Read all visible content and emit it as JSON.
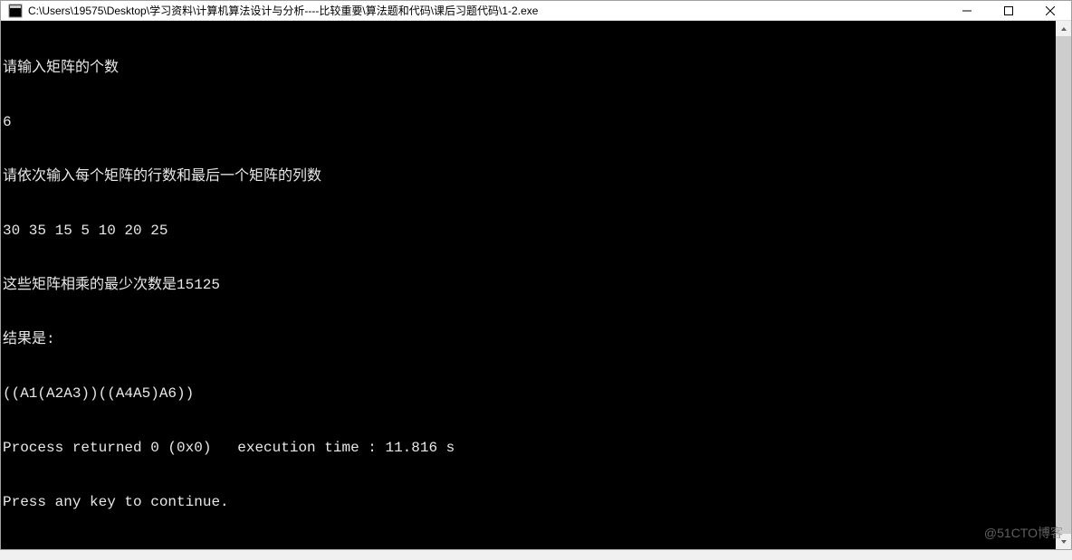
{
  "window": {
    "title": "C:\\Users\\19575\\Desktop\\学习资料\\计算机算法设计与分析----比较重要\\算法题和代码\\课后习题代码\\1-2.exe"
  },
  "console": {
    "lines": [
      "请输入矩阵的个数",
      "6",
      "请依次输入每个矩阵的行数和最后一个矩阵的列数",
      "30 35 15 5 10 20 25",
      "这些矩阵相乘的最少次数是15125",
      "结果是:",
      "((A1(A2A3))((A4A5)A6))",
      "Process returned 0 (0x0)   execution time : 11.816 s",
      "Press any key to continue."
    ]
  },
  "watermark": "@51CTO博客"
}
